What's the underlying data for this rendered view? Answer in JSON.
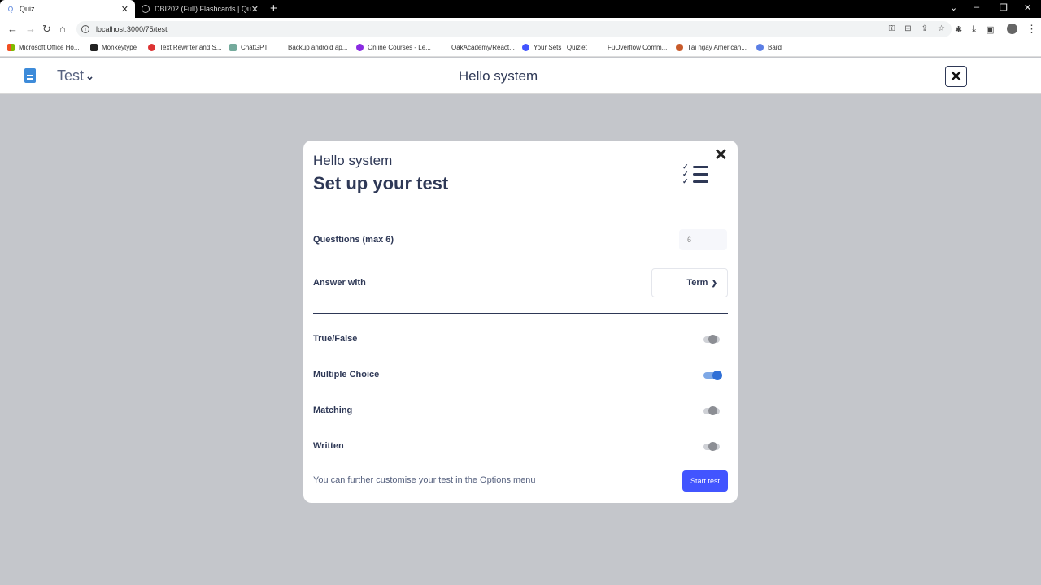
{
  "browser": {
    "tabs": [
      {
        "title": "Quiz",
        "active": true
      },
      {
        "title": "DBI202 (Full) Flashcards | Quizlet",
        "active": false
      }
    ],
    "url": "localhost:3000/75/test",
    "bookmarks": [
      {
        "label": "Microsoft Office Ho..."
      },
      {
        "label": "Monkeytype"
      },
      {
        "label": "Text Rewriter and S..."
      },
      {
        "label": "ChatGPT"
      },
      {
        "label": "Backup android ap..."
      },
      {
        "label": "Online Courses - Le..."
      },
      {
        "label": "OakAcademy/React..."
      },
      {
        "label": "Your Sets | Quizlet"
      },
      {
        "label": "FuOverflow Comm..."
      },
      {
        "label": "Tải ngay American..."
      },
      {
        "label": "Bard"
      }
    ]
  },
  "header": {
    "mode_label": "Test",
    "title": "Hello system"
  },
  "modal": {
    "subtitle": "Hello system",
    "title": "Set up your test",
    "questions_label": "Questtions (max 6)",
    "questions_value": "6",
    "answer_with_label": "Answer with",
    "answer_with_value": "Term",
    "options": [
      {
        "label": "True/False",
        "enabled": false
      },
      {
        "label": "Multiple Choice",
        "enabled": true
      },
      {
        "label": "Matching",
        "enabled": false
      },
      {
        "label": "Written",
        "enabled": false
      }
    ],
    "note": "You can further customise your test in the Options menu",
    "start_label": "Start test"
  },
  "colors": {
    "accent": "#4255ff",
    "toggle_on": "#2f6fd6",
    "text_primary": "#2e3856",
    "overlay": "#c4c6cb"
  }
}
